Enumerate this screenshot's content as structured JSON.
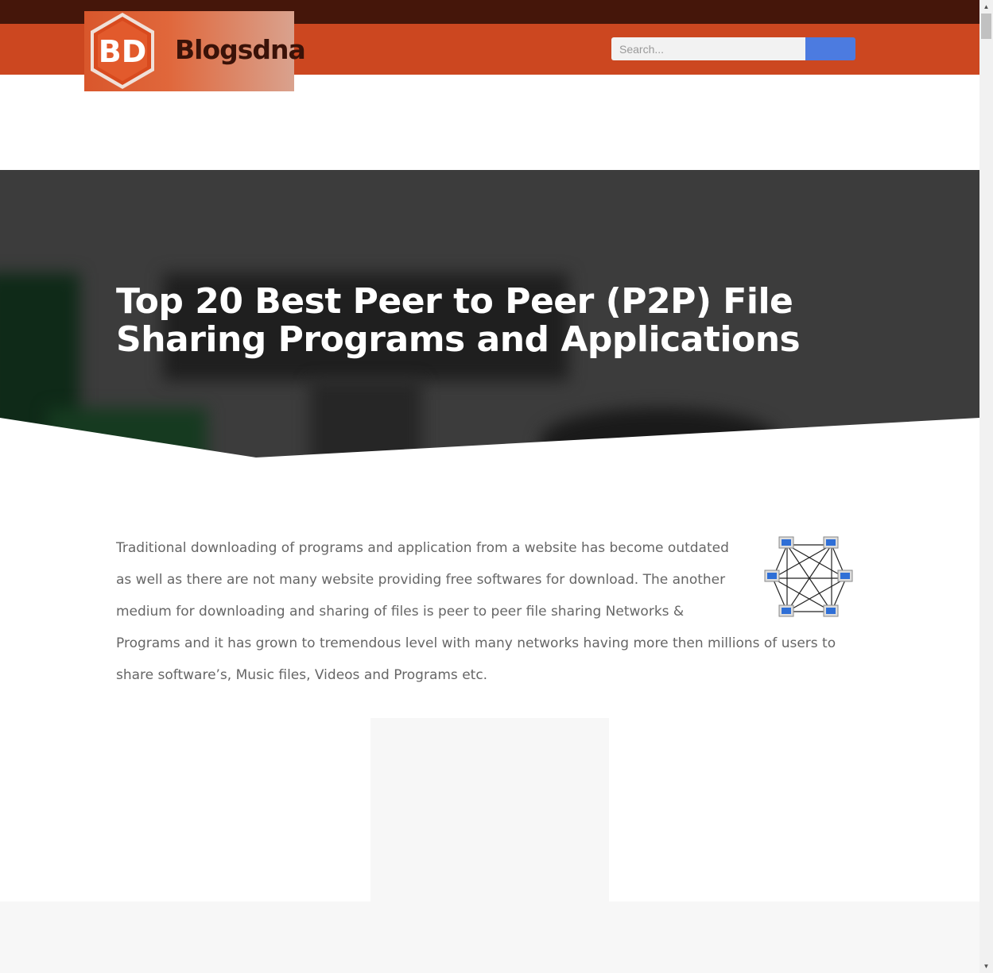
{
  "header": {
    "logo_text": "Blogsdna",
    "logo_mark": "BD",
    "search": {
      "placeholder": "Search..."
    }
  },
  "hero": {
    "title": "Top 20 Best Peer to Peer (P2P) File Sharing Programs and Applications"
  },
  "article": {
    "intro": "Traditional downloading of programs and application from a website has become outdated as well as there are not many website providing free softwares for download. The another medium for downloading and sharing of files is peer to peer file sharing Networks & Programs and it has grown to tremendous level with many networks having more then millions of users to share software’s, Music files, Videos and Programs etc.",
    "image_icon": "p2p-network-diagram"
  },
  "colors": {
    "topbar": "#45160a",
    "header": "#cc4720",
    "search_button": "#4c7be0",
    "hero_bg": "#3c3c3c"
  }
}
